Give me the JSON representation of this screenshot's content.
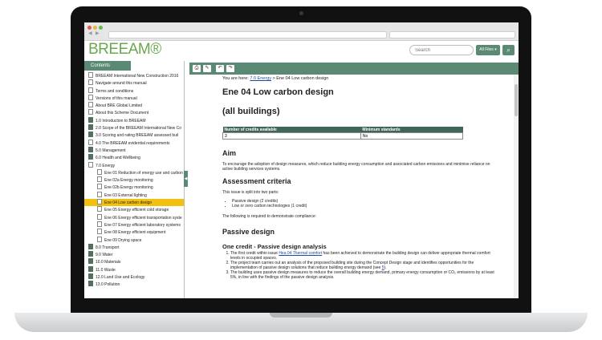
{
  "app": {
    "logo": "BREEAM®"
  },
  "search": {
    "placeholder": "Search",
    "filter_label": "All Files ▾",
    "button_icon": "search-icon"
  },
  "sidebar": {
    "tab_label": "Contents",
    "items": [
      {
        "label": "BREEAM International New Construction 2016",
        "icon": "page",
        "indent": 0
      },
      {
        "label": "Navigate around this manual",
        "icon": "page",
        "indent": 0
      },
      {
        "label": "Terms and conditions",
        "icon": "page",
        "indent": 0
      },
      {
        "label": "Versions of this manual",
        "icon": "page",
        "indent": 0
      },
      {
        "label": "About BRE Global Limited",
        "icon": "page",
        "indent": 0
      },
      {
        "label": "About this Scheme Document",
        "icon": "page",
        "indent": 0
      },
      {
        "label": "1.0 Introduction to BREEAM",
        "icon": "book",
        "indent": 0
      },
      {
        "label": "2.0 Scope of the BREEAM International New Co",
        "icon": "book",
        "indent": 0
      },
      {
        "label": "3.0 Scoring and rating BREEAM assessed buil",
        "icon": "book",
        "indent": 0
      },
      {
        "label": "4.0 The BREEAM evidential requirements",
        "icon": "page",
        "indent": 0
      },
      {
        "label": "5.0 Management",
        "icon": "book",
        "indent": 0
      },
      {
        "label": "6.0 Health and Wellbeing",
        "icon": "book",
        "indent": 0
      },
      {
        "label": "7.0 Energy",
        "icon": "page",
        "indent": 0
      },
      {
        "label": "Ene 01 Reduction of energy use and carbon",
        "icon": "page",
        "indent": 1
      },
      {
        "label": "Ene 02a Energy monitoring",
        "icon": "page",
        "indent": 1
      },
      {
        "label": "Ene 02b Energy monitoring",
        "icon": "page",
        "indent": 1
      },
      {
        "label": "Ene 03 External lighting",
        "icon": "page",
        "indent": 1
      },
      {
        "label": "Ene 04 Low carbon design",
        "icon": "page",
        "indent": 1,
        "selected": true
      },
      {
        "label": "Ene 05 Energy efficient cold storage",
        "icon": "page",
        "indent": 1
      },
      {
        "label": "Ene 06 Energy efficient transportation syste",
        "icon": "page",
        "indent": 1
      },
      {
        "label": "Ene 07 Energy efficient laboratory systems",
        "icon": "page",
        "indent": 1
      },
      {
        "label": "Ene 08 Energy efficient equipment",
        "icon": "page",
        "indent": 1
      },
      {
        "label": "Ene 09 Drying space",
        "icon": "page",
        "indent": 1
      },
      {
        "label": "8.0 Transport",
        "icon": "book",
        "indent": 0
      },
      {
        "label": "9.0 Water",
        "icon": "book",
        "indent": 0
      },
      {
        "label": "10.0 Materials",
        "icon": "book",
        "indent": 0
      },
      {
        "label": "11.0 Waste",
        "icon": "book",
        "indent": 0
      },
      {
        "label": "12.0 Land Use and Ecology",
        "icon": "book",
        "indent": 0
      },
      {
        "label": "13.0 Pollution",
        "icon": "book",
        "indent": 0
      }
    ]
  },
  "toolbar": {
    "buttons": [
      "print-icon",
      "tools-icon",
      "back-icon",
      "forward-icon"
    ]
  },
  "content": {
    "breadcrumb_prefix": "You are here:",
    "breadcrumb_link": "7.0 Energy",
    "breadcrumb_rest": "> Ene 04 Low carbon design",
    "title": "Ene 04 Low carbon design",
    "subtitle": "(all buildings)",
    "table": {
      "headers": [
        "Number of credits available",
        "Minimum standards"
      ],
      "row": [
        "3",
        "No"
      ]
    },
    "aim_heading": "Aim",
    "aim_text": "To encourage the adoption of design measures, which reduce building energy consumption and associated carbon emissions and minimise reliance on active building services systems.",
    "assessment_heading": "Assessment criteria",
    "assessment_intro": "This issue is split into two parts:",
    "assessment_bullets": [
      "Passive design (2 credits)",
      "Low or zero carbon technologies (1 credit)"
    ],
    "assessment_follow": "The following is required to demonstrate compliance:",
    "passive_heading": "Passive design",
    "one_credit_heading": "One credit - Passive design analysis",
    "steps": [
      {
        "pre": "The first credit within issue ",
        "link": "Hea 04 Thermal comfort",
        "post": " has been achieved to demonstrate the building design can deliver appropriate thermal comfort levels in occupied spaces."
      },
      {
        "pre": "The project team carries out an analysis of the proposed building site during the Concept Design stage and identifies opportunities for the implementation of passive design solutions that reduce building energy demand (see ",
        "link": "5",
        "post": ")."
      },
      {
        "pre": "The building uses passive design measures to reduce the overall building energy demand, primary energy consumption or CO₂ emissions by at least 5%, in line with the findings of the passive design analysis.",
        "link": "",
        "post": ""
      }
    ]
  }
}
